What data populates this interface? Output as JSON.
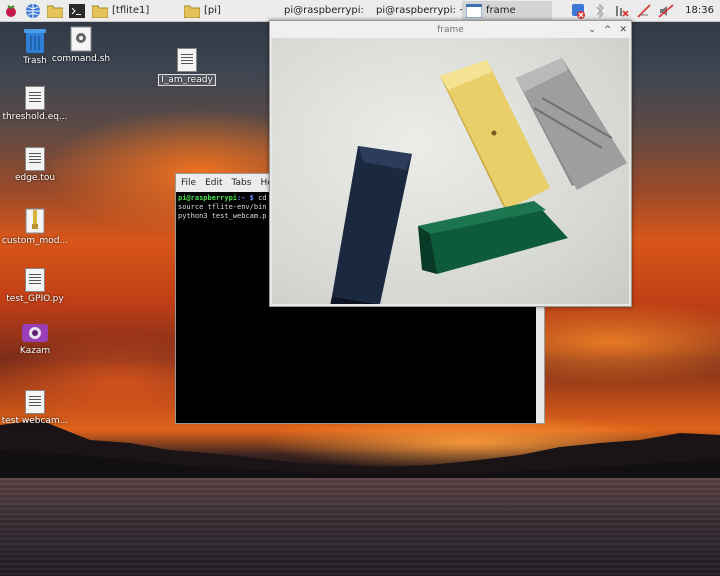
{
  "taskbar": {
    "tasks": [
      {
        "label": "[tflite1]"
      },
      {
        "label": "[pi]"
      },
      {
        "label": "pi@raspberrypi: ..."
      },
      {
        "label": "pi@raspberrypi: ~"
      },
      {
        "label": "frame"
      }
    ],
    "clock": "18:36"
  },
  "desktop": {
    "icons": [
      {
        "label": "Trash"
      },
      {
        "label": "command.sh"
      },
      {
        "label": "I_am_ready"
      },
      {
        "label": "threshold.eq..."
      },
      {
        "label": "edge.tou"
      },
      {
        "label": "custom_mod..."
      },
      {
        "label": "test_GPIO.py"
      },
      {
        "label": "Kazam"
      },
      {
        "label": "test webcam..."
      }
    ]
  },
  "terminal": {
    "menu": [
      "File",
      "Edit",
      "Tabs",
      "Hel"
    ],
    "lines": [
      {
        "user": "pi@raspberrypi",
        "path": ":~ $",
        "cmd": " cd"
      },
      {
        "text": "source tflite-env/bin"
      },
      {
        "text": "python3 test_webcam.p"
      }
    ]
  },
  "frame_window": {
    "title": "frame",
    "controls": [
      "⌄",
      "^",
      "✕"
    ]
  },
  "colors": {
    "accent_terminal_user": "#4be04b",
    "accent_terminal_path": "#6a8cff"
  }
}
